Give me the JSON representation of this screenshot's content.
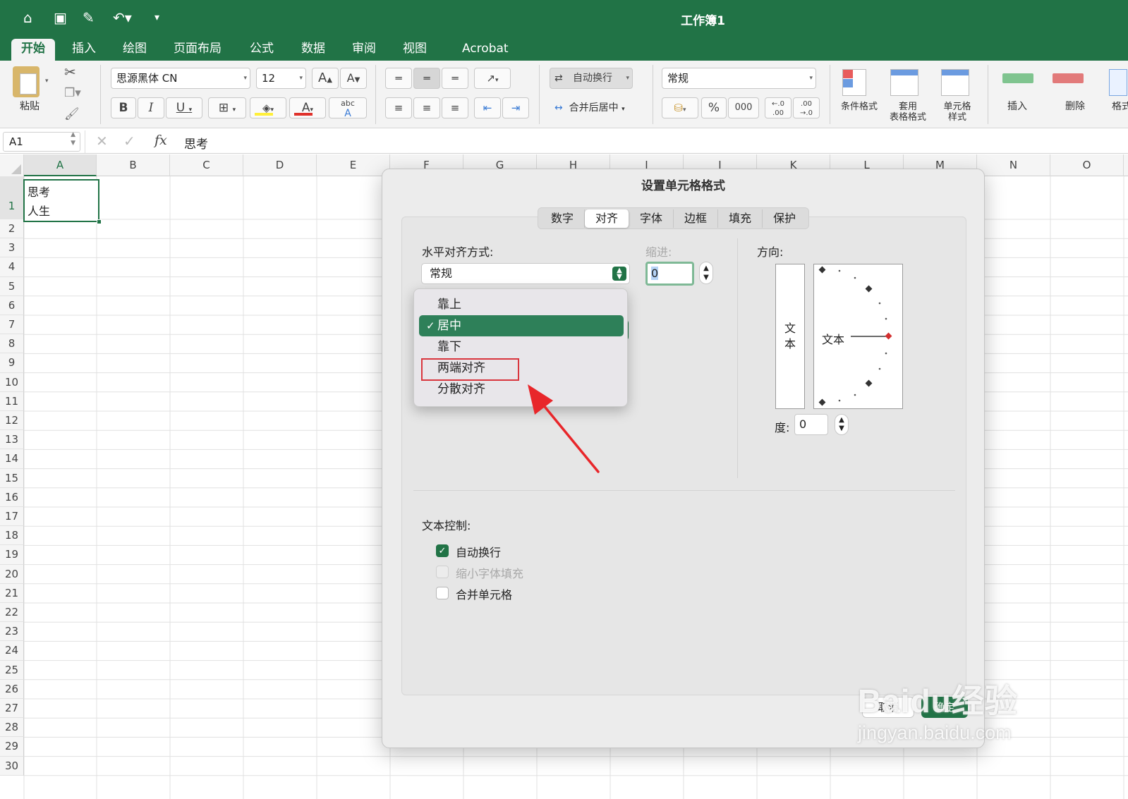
{
  "window": {
    "title": "工作簿1"
  },
  "ribbon_tabs": [
    "开始",
    "插入",
    "绘图",
    "页面布局",
    "公式",
    "数据",
    "审阅",
    "视图",
    "Acrobat"
  ],
  "ribbon": {
    "paste": "粘贴",
    "font_name": "思源黑体 CN",
    "font_size": "12",
    "wrap_text": "自动换行",
    "merge_center": "合并后居中",
    "number_format": "常规",
    "percent": "%",
    "thousands": "000",
    "cond_format": "条件格式",
    "table_format": "套用\n表格格式",
    "cell_style": "单元格\n样式",
    "insert": "插入",
    "delete": "删除",
    "format_partial": "格式"
  },
  "formula_bar": {
    "name_box": "A1",
    "fx": "fx",
    "content": "思考"
  },
  "columns": [
    "A",
    "B",
    "C",
    "D",
    "E",
    "F",
    "G",
    "H",
    "I",
    "J",
    "K",
    "L",
    "M",
    "N",
    "O"
  ],
  "rows": [
    "1",
    "2",
    "3",
    "4",
    "5",
    "6",
    "7",
    "8",
    "9",
    "10",
    "11",
    "12",
    "13",
    "14",
    "15",
    "16",
    "17",
    "18",
    "19",
    "20",
    "21",
    "22",
    "23",
    "24",
    "25",
    "26",
    "27",
    "28",
    "29",
    "30"
  ],
  "cell_a1": {
    "line1": "思考",
    "line2": "人生"
  },
  "dialog": {
    "title": "设置单元格格式",
    "tabs": [
      "数字",
      "对齐",
      "字体",
      "边框",
      "填充",
      "保护"
    ],
    "active_tab": "对齐",
    "horizontal_label": "水平对齐方式:",
    "horizontal_value": "常规",
    "indent_label": "缩进:",
    "indent_value": "0",
    "vertical_options": [
      "靠上",
      "居中",
      "靠下",
      "两端对齐",
      "分散对齐"
    ],
    "vertical_selected": "居中",
    "highlighted_option": "两端对齐",
    "orientation_label": "方向:",
    "orientation_vertical_text": "文本",
    "orientation_text": "文本",
    "degrees_label": "度:",
    "degrees_value": "0",
    "text_control_label": "文本控制:",
    "wrap_text": {
      "label": "自动换行",
      "checked": true
    },
    "shrink_to_fit": {
      "label": "缩小字体填充",
      "checked": false,
      "disabled": true
    },
    "merge_cells": {
      "label": "合并单元格",
      "checked": false
    },
    "cancel": "取消",
    "ok": "确定"
  },
  "watermark": {
    "brand": "Baidu经验",
    "url": "jingyan.baidu.com"
  },
  "colors": {
    "accent": "#217346",
    "highlight_box": "#d9363e",
    "arrow": "#e8262a"
  }
}
